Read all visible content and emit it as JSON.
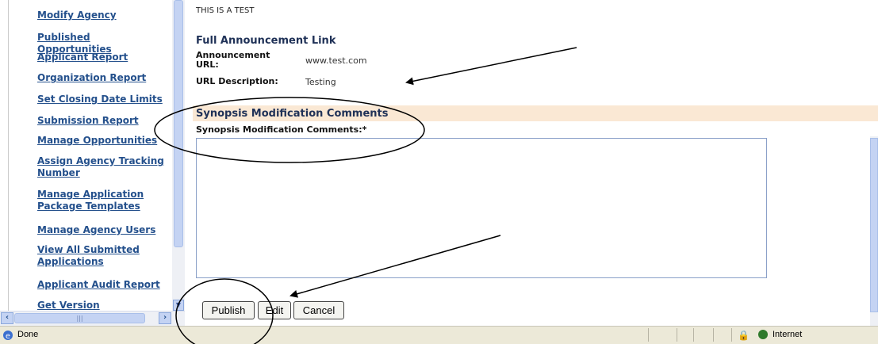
{
  "sidebar": {
    "items": [
      {
        "label": "Modify Agency"
      },
      {
        "label": "Published Opportunities"
      },
      {
        "label": "Applicant Report"
      },
      {
        "label": "Organization Report"
      },
      {
        "label": "Set Closing Date Limits"
      },
      {
        "label": "Submission Report"
      },
      {
        "label": "Manage Opportunities"
      },
      {
        "label": "Assign Agency Tracking Number"
      },
      {
        "label": "Manage Application Package Templates"
      },
      {
        "label": "Manage Agency Users"
      },
      {
        "label": "View All Submitted Applications"
      },
      {
        "label": "Applicant Audit Report"
      },
      {
        "label": "Get Version"
      }
    ]
  },
  "main": {
    "test_text": "THIS IS A TEST",
    "announcement_heading": "Full Announcement Link",
    "url_label": "Announcement URL:",
    "url_value": "www.test.com",
    "url_desc_label": "URL Description:",
    "url_desc_value": "Testing",
    "synopsis_heading": "Synopsis Modification Comments",
    "synopsis_field_label": "Synopsis Modification Comments:*",
    "synopsis_value": ""
  },
  "buttons": {
    "publish": "Publish",
    "edit": "Edit",
    "cancel": "Cancel"
  },
  "status": {
    "left_text": "Done",
    "zone": "Internet"
  },
  "colors": {
    "link": "#24508c",
    "synopsis_bar": "#fae8d4",
    "annotation": "#000000"
  }
}
